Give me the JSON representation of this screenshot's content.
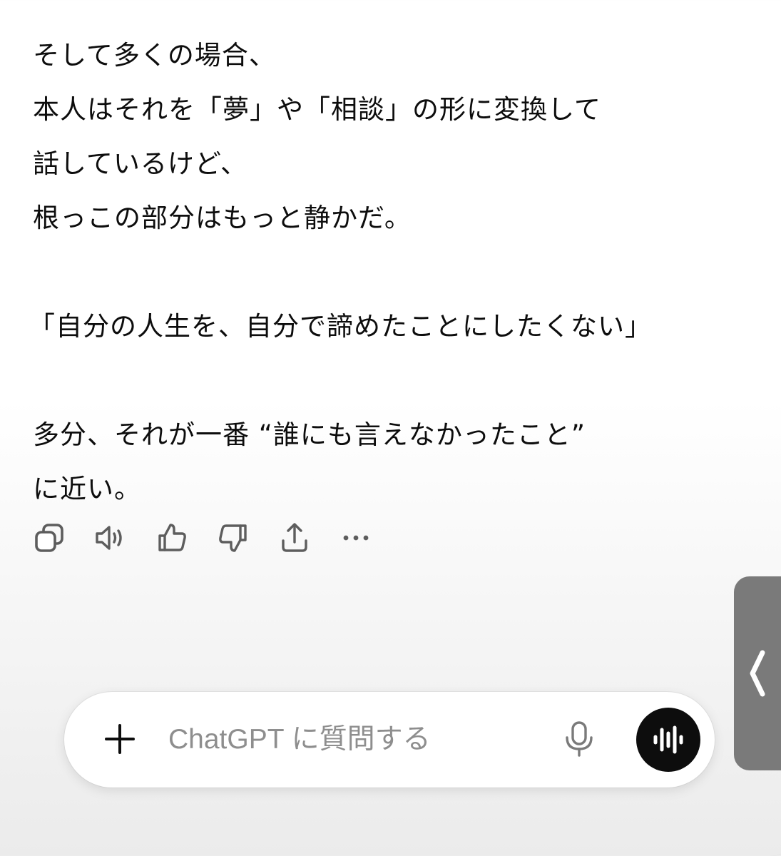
{
  "message": {
    "paragraphs": [
      [
        "そして多くの場合、",
        "本人はそれを「夢」や「相談」の形に変換して",
        "話しているけど、",
        "根っこの部分はもっと静かだ。"
      ],
      [
        "「自分の人生を、自分で諦めたことにしたくない」"
      ],
      [
        "多分、それが一番 “誰にも言えなかったこと”",
        "に近い。"
      ]
    ]
  },
  "actions": [
    {
      "icon": "copy-icon"
    },
    {
      "icon": "read-aloud-icon"
    },
    {
      "icon": "thumbs-up-icon"
    },
    {
      "icon": "thumbs-down-icon"
    },
    {
      "icon": "share-icon"
    },
    {
      "icon": "more-icon"
    }
  ],
  "composer": {
    "placeholder": "ChatGPT に質問する",
    "value": ""
  },
  "colors": {
    "text": "#0d0d0d",
    "placeholder": "#8e8e8e",
    "icon": "#5d5d5d",
    "voice_button": "#0d0d0d",
    "side_tab": "#7a7a7a"
  }
}
